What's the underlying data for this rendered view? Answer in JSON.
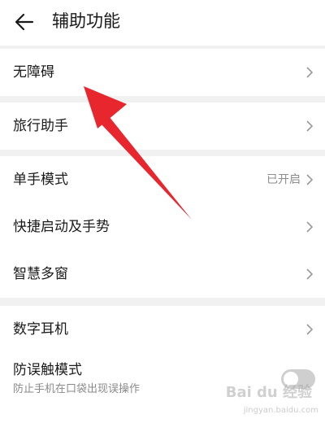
{
  "header": {
    "title": "辅助功能"
  },
  "groups": [
    {
      "items": [
        {
          "label": "无障碍"
        }
      ]
    },
    {
      "items": [
        {
          "label": "旅行助手"
        }
      ]
    },
    {
      "items": [
        {
          "label": "单手模式",
          "value": "已开启"
        },
        {
          "label": "快捷启动及手势"
        },
        {
          "label": "智慧多窗"
        }
      ]
    },
    {
      "items": [
        {
          "label": "数字耳机"
        },
        {
          "label": "防误触模式",
          "subtitle": "防止手机在口袋出现误操作",
          "toggle_on": false
        }
      ]
    }
  ],
  "colors": {
    "annotation_arrow": "#e8262e",
    "background": "#f1f1f1"
  },
  "watermark": {
    "text": "Bai du 经验",
    "url": "jingyan.baidu.com"
  }
}
